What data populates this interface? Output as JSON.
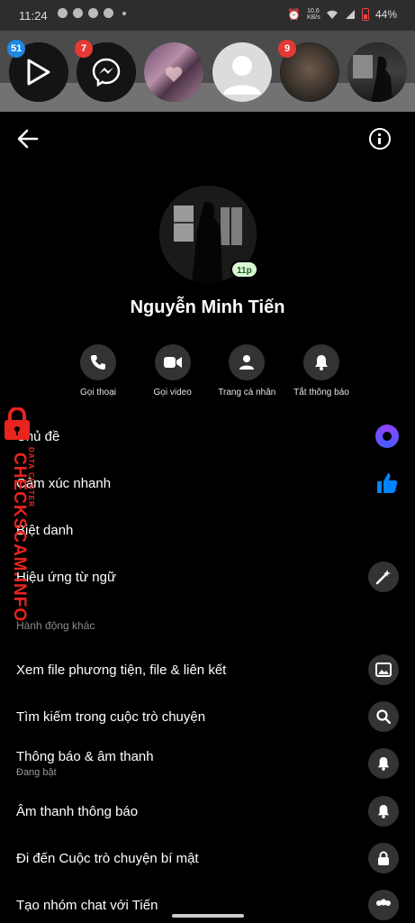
{
  "status_bar": {
    "time": "11:24",
    "net_speed_value": "10,6",
    "net_speed_unit": "KB/s",
    "battery": "44%"
  },
  "chat_heads": [
    {
      "name": "video-app-head",
      "badge": "51",
      "badge_color": "#1e88e5"
    },
    {
      "name": "messenger-head",
      "badge": "7",
      "badge_color": "#e53935"
    },
    {
      "name": "photo-collage-head",
      "badge": "",
      "badge_color": ""
    },
    {
      "name": "default-avatar-head",
      "badge": "",
      "badge_color": ""
    },
    {
      "name": "blurred-photo-head",
      "badge": "9",
      "badge_color": "#e53935"
    },
    {
      "name": "profile-head",
      "badge": "",
      "badge_color": ""
    }
  ],
  "profile": {
    "name": "Nguyễn Minh Tiến",
    "presence": "11p"
  },
  "actions": [
    {
      "icon": "phone-icon",
      "label": "Gọi thoại"
    },
    {
      "icon": "video-icon",
      "label": "Gọi video"
    },
    {
      "icon": "person-icon",
      "label": "Trang cá nhân"
    },
    {
      "icon": "bell-icon",
      "label": "Tắt thông báo"
    }
  ],
  "menu": {
    "theme": "Chủ đề",
    "quick_reaction": "Cảm xúc nhanh",
    "nicknames": "Biệt danh",
    "word_effects": "Hiệu ứng từ ngữ",
    "section_other": "Hành động khác",
    "view_media": "Xem file phương tiện, file & liên kết",
    "search": "Tìm kiếm trong cuộc trò chuyện",
    "notifications": "Thông báo & âm thanh",
    "notifications_sub": "Đang bật",
    "notification_sound": "Âm thanh thông báo",
    "secret_chat": "Đi đến Cuộc trò chuyện bí mật",
    "create_group": "Tạo nhóm chat với Tiến"
  },
  "watermark": {
    "main": "CHECKSCAM.INFO",
    "sub": "DATA CENTER"
  },
  "colors": {
    "accent": "#0084ff",
    "theme_purple": "#8e44ff",
    "badge_red": "#e53935",
    "badge_blue": "#1e88e5"
  }
}
